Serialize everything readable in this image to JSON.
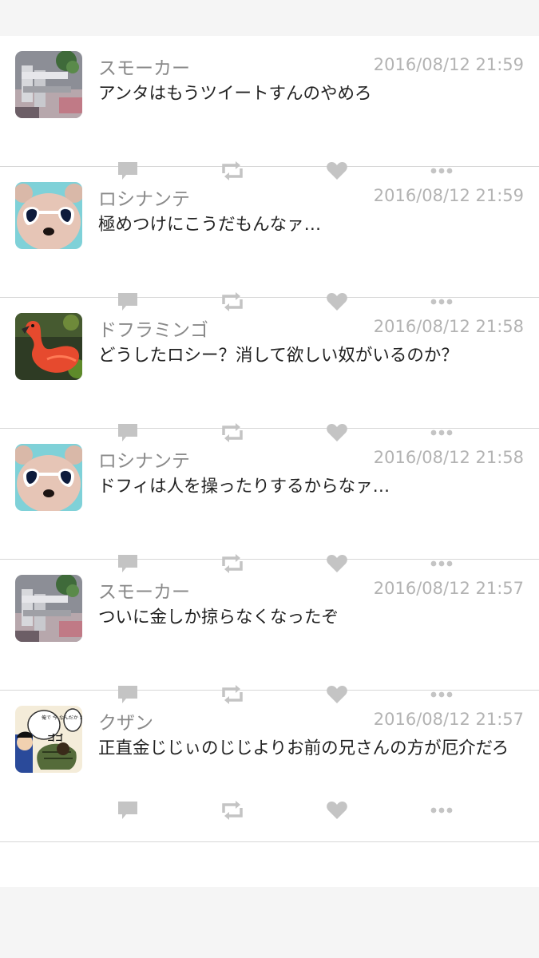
{
  "colors": {
    "icon": "#c4c4c4",
    "name": "#8a8a8a",
    "time": "#b3b3b3",
    "text": "#222222",
    "divider": "#d6d6d6"
  },
  "tweets": [
    {
      "avatar": "smoker-avatar",
      "name": "スモーカー",
      "time": "2016/08/12 21:59",
      "text": "アンタはもうツイートすんのやめろ"
    },
    {
      "avatar": "bear-avatar",
      "name": "ロシナンテ",
      "time": "2016/08/12 21:59",
      "text": "極めつけにこうだもんなァ…"
    },
    {
      "avatar": "flamingo-avatar",
      "name": "ドフラミンゴ",
      "time": "2016/08/12 21:58",
      "text": "どうしたロシー？消して欲しい奴がいるのか？"
    },
    {
      "avatar": "bear-avatar",
      "name": "ロシナンテ",
      "time": "2016/08/12 21:58",
      "text": "ドフィは人を操ったりするからなァ…"
    },
    {
      "avatar": "smoker-avatar",
      "name": "スモーカー",
      "time": "2016/08/12 21:57",
      "text": "ついに金しか掠らなくなったぞ"
    },
    {
      "avatar": "manga-avatar",
      "name": "クザン",
      "time": "2016/08/12 21:57",
      "text": "正直金じじぃのじじよりお前の兄さんの方が厄介だろ",
      "avatar_text": "俺で 今 なんだか だるい ゴゴ"
    }
  ],
  "action_icons": [
    "comment-icon",
    "retweet-icon",
    "like-icon",
    "more-icon"
  ]
}
